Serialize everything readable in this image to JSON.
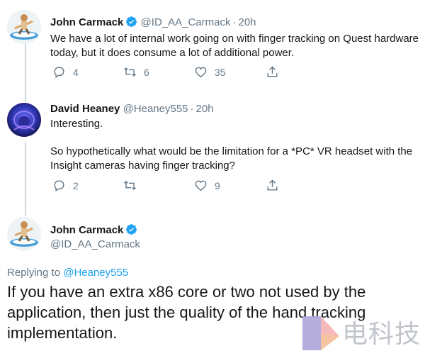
{
  "tweets": [
    {
      "name": "John Carmack",
      "handle": "@ID_AA_Carmack",
      "time": "20h",
      "text": "We have a lot of internal work going on with finger tracking on Quest hardware today, but it does consume a lot of additional power.",
      "replies": "4",
      "retweets": "6",
      "likes": "35"
    },
    {
      "name": "David Heaney",
      "handle": "@Heaney555",
      "time": "20h",
      "text_line1": "Interesting.",
      "text_line2": "So hypothetically what would be the limitation for a *PC* VR headset with the Insight cameras having finger tracking?",
      "replies": "2",
      "retweets": "",
      "likes": "9"
    }
  ],
  "main_tweet": {
    "name": "John Carmack",
    "handle": "@ID_AA_Carmack",
    "replying_label": "Replying to",
    "replying_to": "@Heaney555",
    "text": "If you have an extra x86 core or two not used by the application, then just the quality of the hand tracking implementation."
  },
  "separator_dot": "·",
  "watermark": {
    "text": "电科技"
  },
  "colors": {
    "accent": "#1da1f2",
    "muted": "#657786",
    "text": "#14171a",
    "border": "#e6ecf0"
  },
  "icons": [
    "verified-icon",
    "reply-icon",
    "retweet-icon",
    "like-icon",
    "share-icon"
  ]
}
